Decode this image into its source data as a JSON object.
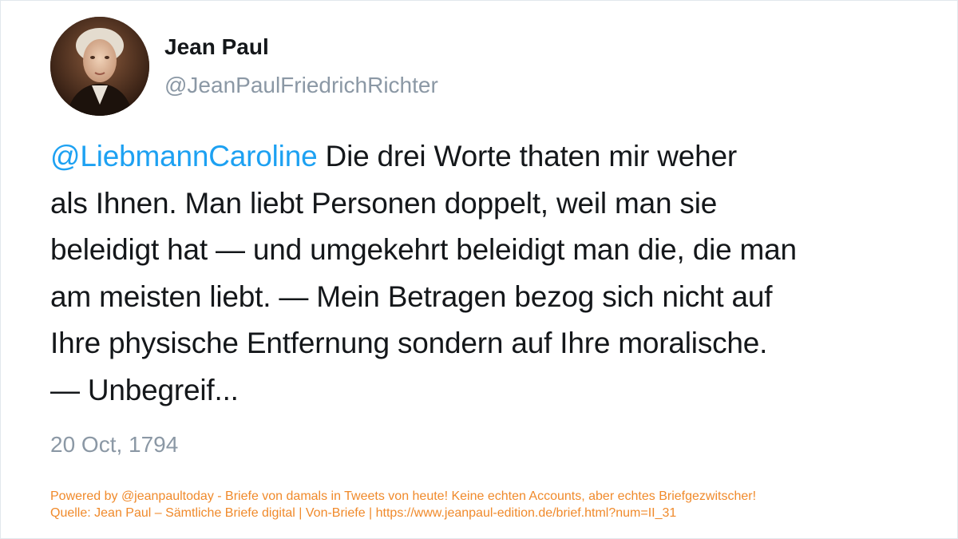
{
  "author": {
    "name": "Jean Paul",
    "handle": "@JeanPaulFriedrichRichter",
    "avatar_icon": "portrait-avatar"
  },
  "tweet": {
    "mention": "@LiebmannCaroline",
    "lines": [
      " Die drei Worte thaten mir weher",
      "als Ihnen. Man liebt Personen doppelt, weil man sie",
      "beleidigt hat — und umgekehrt beleidigt man die, die man",
      "am meisten liebt. — Mein Betragen bezog sich nicht auf",
      "Ihre physische Entfernung sondern auf Ihre moralische.",
      "— Unbegreif..."
    ],
    "date": "20 Oct, 1794"
  },
  "footer": {
    "powered_by": "Powered by @jeanpaultoday - Briefe von damals in Tweets von heute! Keine echten Accounts, aber echtes Briefgezwitscher!",
    "source": "Quelle: Jean Paul – Sämtliche Briefe digital | Von-Briefe | https://www.jeanpaul-edition.de/brief.html?num=II_31"
  },
  "colors": {
    "mention": "#1da1f2",
    "text": "#14171a",
    "muted": "#8b98a5",
    "footer": "#f08a2b"
  }
}
